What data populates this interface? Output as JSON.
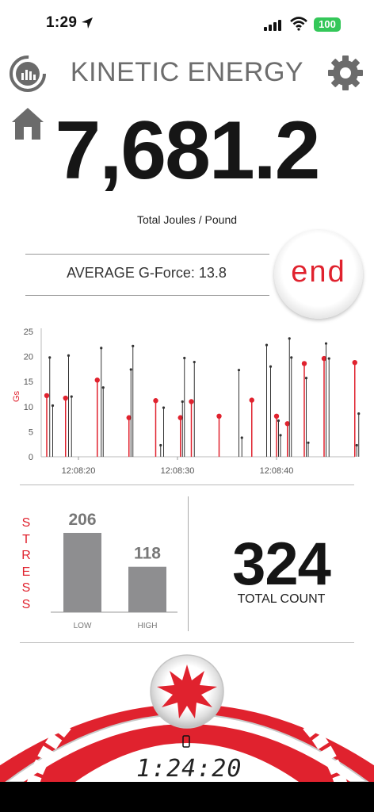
{
  "status_bar": {
    "time": "1:29",
    "battery": "100"
  },
  "header": {
    "title": "KINETIC ENERGY",
    "value": "7,681.2",
    "value_label": "Total Joules / Pound"
  },
  "avg_gforce": {
    "label": "AVERAGE G-Force: 13.8"
  },
  "end_button": {
    "label": "end"
  },
  "chart_data": [
    {
      "type": "scatter",
      "ylabel": "Gs",
      "ylim": [
        0,
        25
      ],
      "yticks": [
        "0",
        "5",
        "10",
        "15",
        "20",
        "25"
      ],
      "xticks": [
        "12:08:20",
        "12:08:30",
        "12:08:40"
      ],
      "grid": false,
      "series": [
        {
          "color": "#e0222e",
          "values": [
            {
              "t": 0.0,
              "g": 12.2
            },
            {
              "t": 1.9,
              "g": 11.7
            },
            {
              "t": 5.1,
              "g": 15.3
            },
            {
              "t": 8.3,
              "g": 7.8
            },
            {
              "t": 11.0,
              "g": 11.2
            },
            {
              "t": 13.5,
              "g": 7.8
            },
            {
              "t": 14.6,
              "g": 11.0
            },
            {
              "t": 17.4,
              "g": 8.1
            },
            {
              "t": 20.7,
              "g": 11.3
            },
            {
              "t": 23.2,
              "g": 8.1
            },
            {
              "t": 24.3,
              "g": 6.6
            },
            {
              "t": 26.0,
              "g": 18.6
            },
            {
              "t": 28.0,
              "g": 19.6
            },
            {
              "t": 31.1,
              "g": 18.8
            }
          ]
        },
        {
          "color": "#333333",
          "values": [
            {
              "t": 0.3,
              "g": 19.8
            },
            {
              "t": 0.6,
              "g": 10.2
            },
            {
              "t": 2.2,
              "g": 20.2
            },
            {
              "t": 2.5,
              "g": 12.0
            },
            {
              "t": 5.5,
              "g": 21.7
            },
            {
              "t": 5.7,
              "g": 13.8
            },
            {
              "t": 8.5,
              "g": 17.4
            },
            {
              "t": 8.7,
              "g": 22.1
            },
            {
              "t": 11.5,
              "g": 2.3
            },
            {
              "t": 11.8,
              "g": 9.8
            },
            {
              "t": 13.7,
              "g": 11.0
            },
            {
              "t": 13.9,
              "g": 19.7
            },
            {
              "t": 14.9,
              "g": 18.9
            },
            {
              "t": 19.4,
              "g": 17.3
            },
            {
              "t": 19.7,
              "g": 3.8
            },
            {
              "t": 22.2,
              "g": 22.3
            },
            {
              "t": 22.6,
              "g": 18.0
            },
            {
              "t": 24.5,
              "g": 23.6
            },
            {
              "t": 24.7,
              "g": 19.8
            },
            {
              "t": 23.4,
              "g": 7.2
            },
            {
              "t": 23.6,
              "g": 4.3
            },
            {
              "t": 26.2,
              "g": 15.7
            },
            {
              "t": 26.4,
              "g": 2.8
            },
            {
              "t": 28.2,
              "g": 22.6
            },
            {
              "t": 28.5,
              "g": 19.6
            },
            {
              "t": 31.3,
              "g": 2.3
            },
            {
              "t": 31.5,
              "g": 8.6
            }
          ]
        }
      ]
    },
    {
      "type": "bar",
      "ylabel": "STRESS",
      "categories": [
        "LOW",
        "HIGH"
      ],
      "values": [
        206,
        118
      ],
      "color": "#8e8e90"
    }
  ],
  "stress": {
    "label_letters": [
      "S",
      "T",
      "R",
      "E",
      "S",
      "S"
    ]
  },
  "total": {
    "value": "324",
    "label": "TOTAL COUNT"
  },
  "timer": {
    "value": "1:24:20"
  },
  "colors": {
    "accent": "#e0222e",
    "bar": "#8e8e90",
    "battery": "#34c759"
  },
  "icons": {
    "stats": "stats-logo-icon",
    "settings": "gear-icon",
    "home": "home-icon",
    "burst": "burst-icon"
  }
}
